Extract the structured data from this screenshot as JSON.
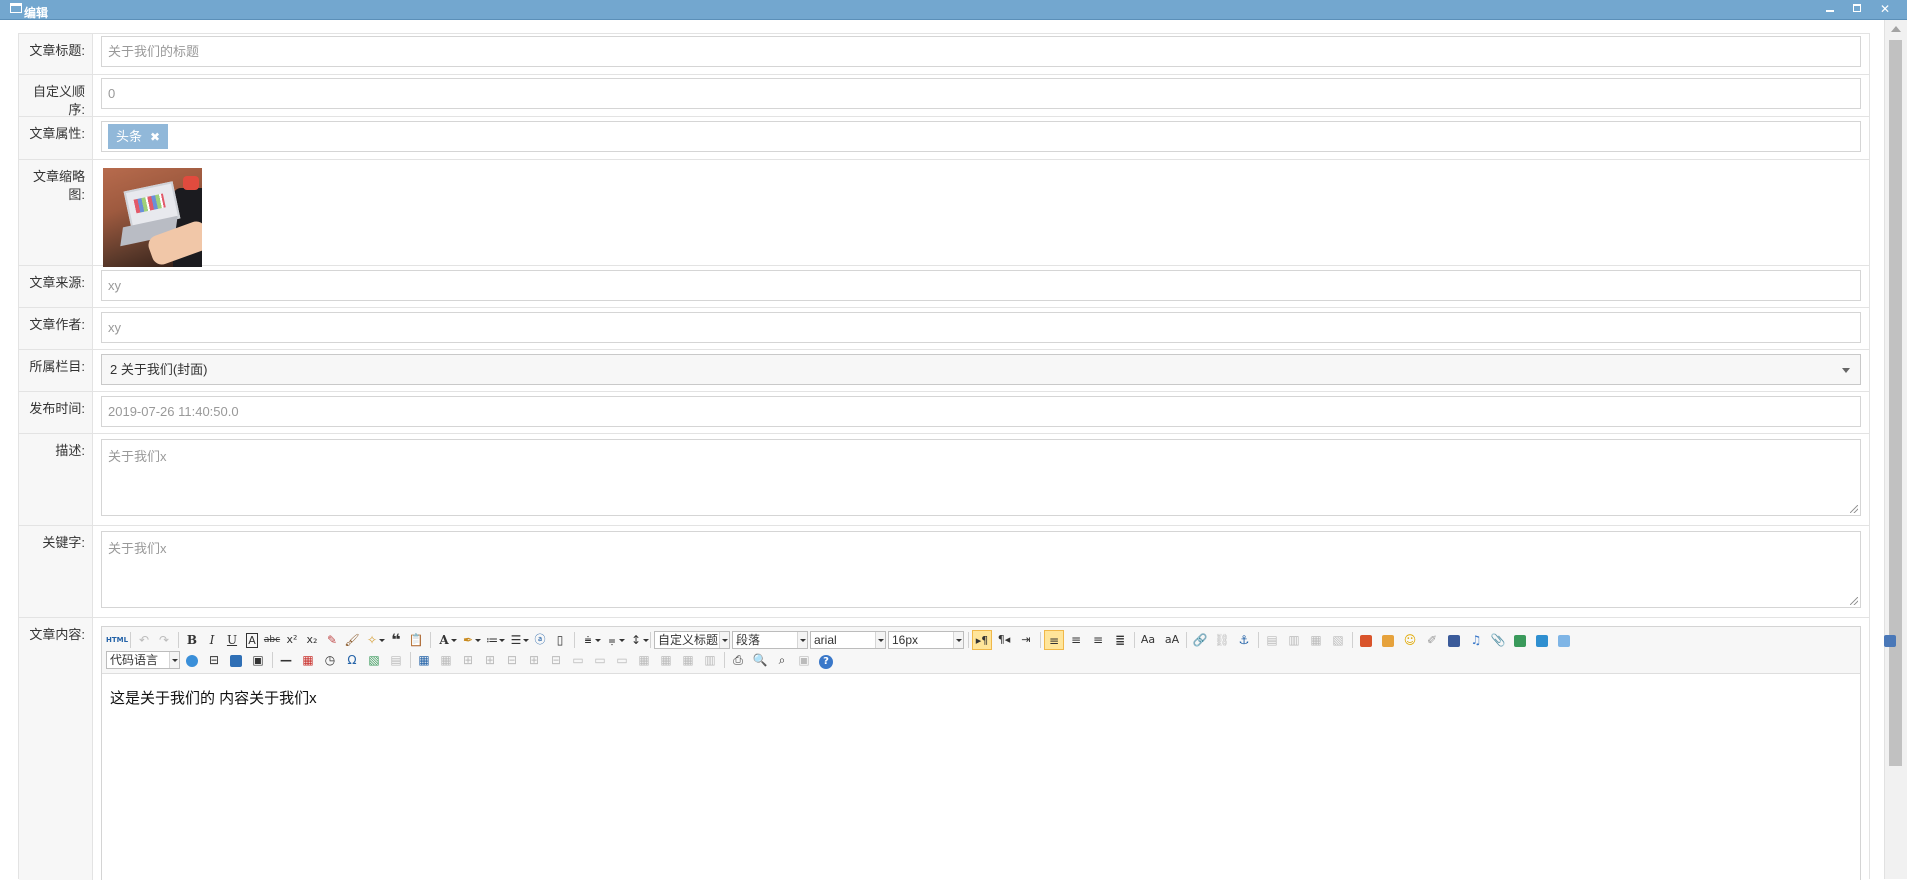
{
  "window": {
    "title": "编辑"
  },
  "form": {
    "title": {
      "label": "文章标题:",
      "value": "关于我们的标题"
    },
    "order": {
      "label": "自定义顺序:",
      "value": "0"
    },
    "attrs": {
      "label": "文章属性:",
      "tag": "头条",
      "tag_remove": "✖"
    },
    "thumbnail": {
      "label": "文章缩略图:"
    },
    "source": {
      "label": "文章来源:",
      "value": "xy"
    },
    "author": {
      "label": "文章作者:",
      "value": "xy"
    },
    "column": {
      "label": "所属栏目:",
      "selected": "2 关于我们(封面)"
    },
    "publish_time": {
      "label": "发布时间:",
      "value": "2019-07-26 11:40:50.0"
    },
    "description": {
      "label": "描述:",
      "value": "关于我们x"
    },
    "keywords": {
      "label": "关键字:",
      "value": "关于我们x"
    },
    "content": {
      "label": "文章内容:",
      "value": "这是关于我们的  内容关于我们x"
    }
  },
  "editor_toolbar": {
    "html_label": "HTML",
    "heading_combo": "自定义标题",
    "paragraph_combo": "段落",
    "font_combo": "arial",
    "size_combo": "16px",
    "code_lang_combo": "代码语言",
    "glyphs": {
      "bold": "B",
      "italic": "I",
      "underline": "U",
      "fontborder": "A",
      "strike": "abc",
      "sup": "x²",
      "sub": "x₂",
      "quote": "❝",
      "fontcolor": "A",
      "omega": "Ω",
      "hr": "—",
      "help": "?"
    }
  }
}
